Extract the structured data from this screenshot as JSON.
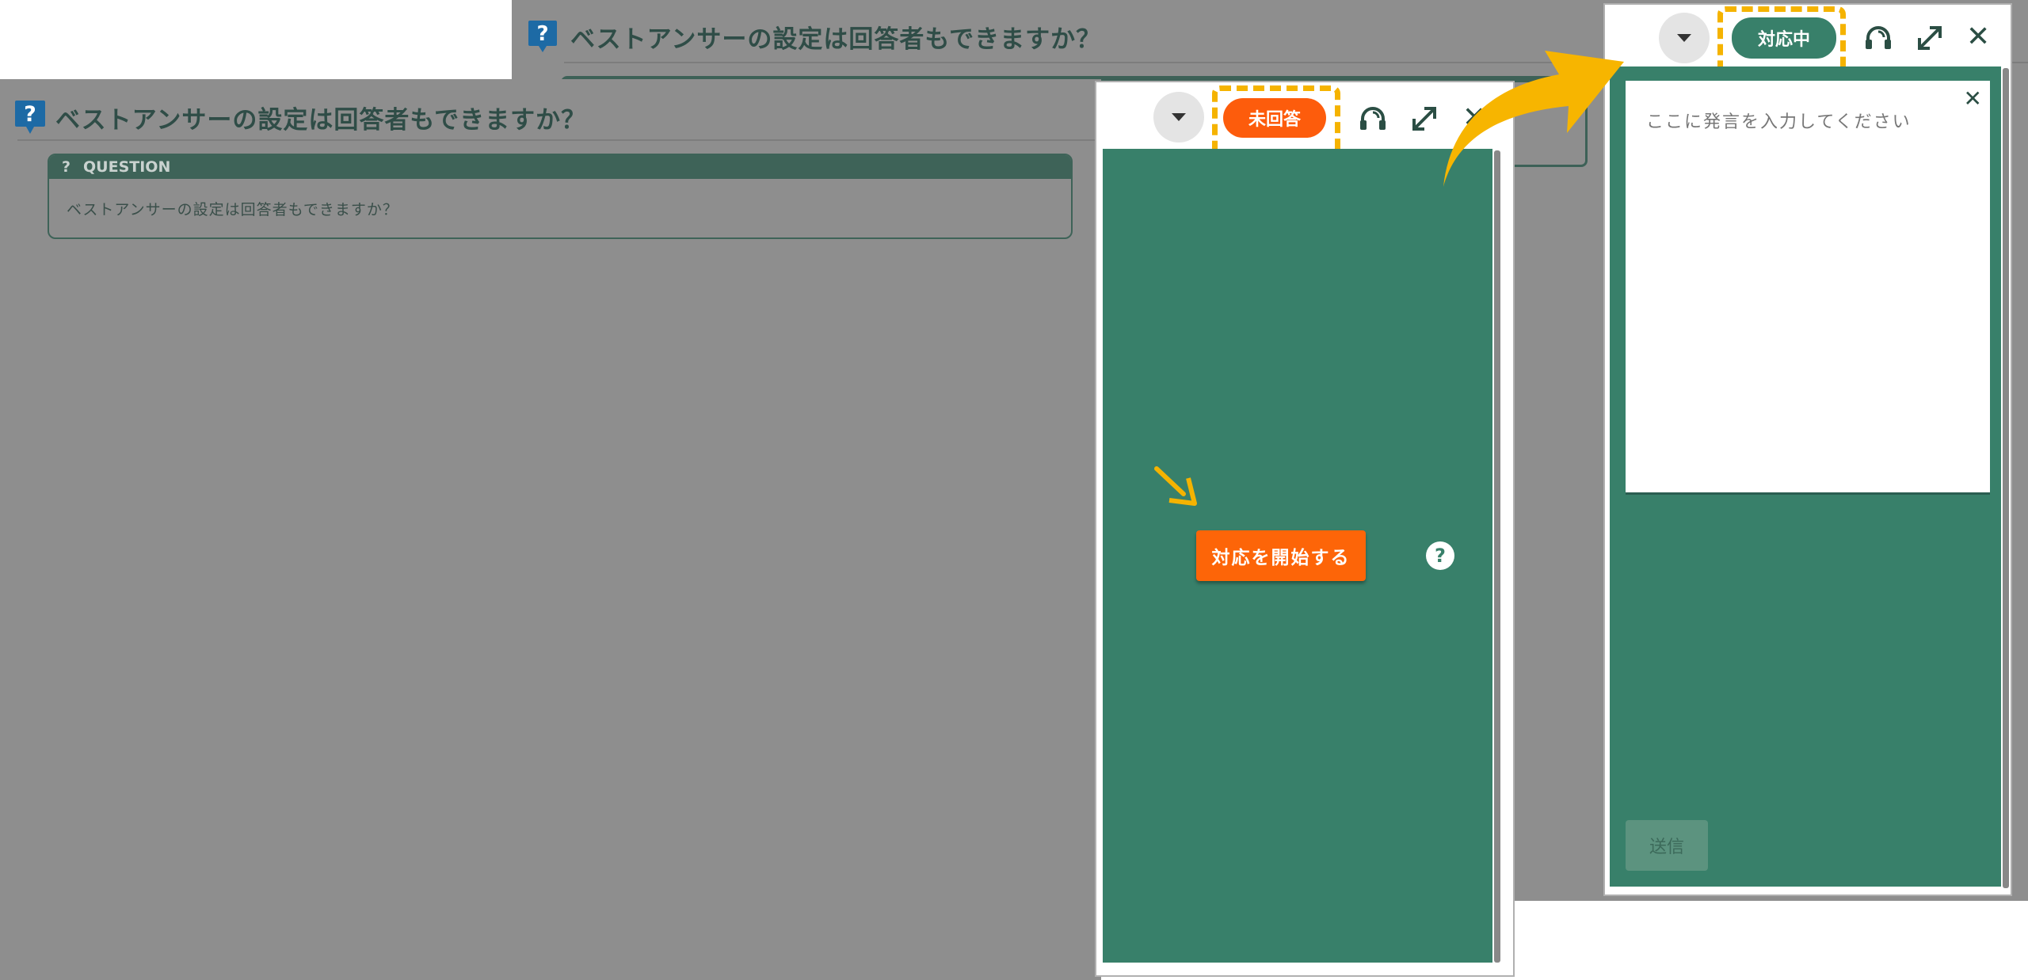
{
  "page_title": "ベストアンサーの設定は回答者もできますか？",
  "question": {
    "header_label": "QUESTION",
    "header_mark": "?",
    "body": "ベストアンサーの設定は回答者もできますか？"
  },
  "panel_before": {
    "status_label": "未回答",
    "start_button_label": "対応を開始する",
    "help_label": "?",
    "close_label": "✕"
  },
  "panel_after": {
    "status_label": "対応中",
    "input_placeholder": "ここに発言を入力してください",
    "send_button_label": "送信",
    "close_label": "✕",
    "input_close_label": "✕"
  },
  "colors": {
    "status_unanswered": "#fd5c0c",
    "status_in_progress": "#38806a",
    "panel_green": "#38806a",
    "highlight": "#f5b300",
    "start_button": "#fd6508"
  },
  "icons": [
    "question-icon",
    "chevron-down-icon",
    "headset-icon",
    "expand-icon",
    "close-icon",
    "pointer-arrow-icon",
    "transition-arrow-icon",
    "help-icon"
  ]
}
